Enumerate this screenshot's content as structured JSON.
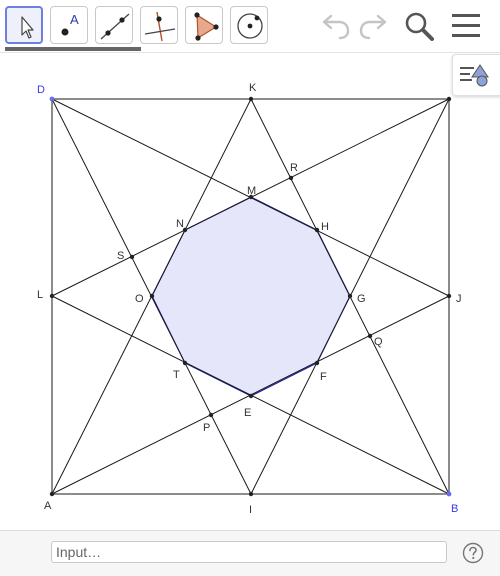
{
  "toolbar": {
    "tools": [
      {
        "name": "move-tool",
        "selected": true
      },
      {
        "name": "point-tool",
        "letter": "A"
      },
      {
        "name": "line-tool"
      },
      {
        "name": "perpendicular-tool"
      },
      {
        "name": "polygon-tool"
      },
      {
        "name": "circle-tool"
      }
    ],
    "undo_icon": "undo-icon",
    "redo_icon": "redo-icon",
    "search_icon": "search-icon",
    "menu_icon": "menu-icon"
  },
  "style_bar_icon": "style-bar-toggle-icon",
  "colors": {
    "polygon_fill": "#e6e6fa",
    "polygon_stroke": "#1a1aa6",
    "segment": "#1a1a1a",
    "label_default": "#333333",
    "label_blue": "#3b3be0",
    "accent": "#6e7fe0"
  },
  "points": {
    "D": "D",
    "K": "K",
    "R": "R",
    "M": "M",
    "N": "N",
    "H": "H",
    "S": "S",
    "L": "L",
    "O": "O",
    "G": "G",
    "J": "J",
    "Q": "Q",
    "T": "T",
    "F": "F",
    "E": "E",
    "P": "P",
    "A": "A",
    "I": "I",
    "B": "B"
  },
  "input_bar": {
    "placeholder": "Input…",
    "help_icon": "help-icon"
  }
}
